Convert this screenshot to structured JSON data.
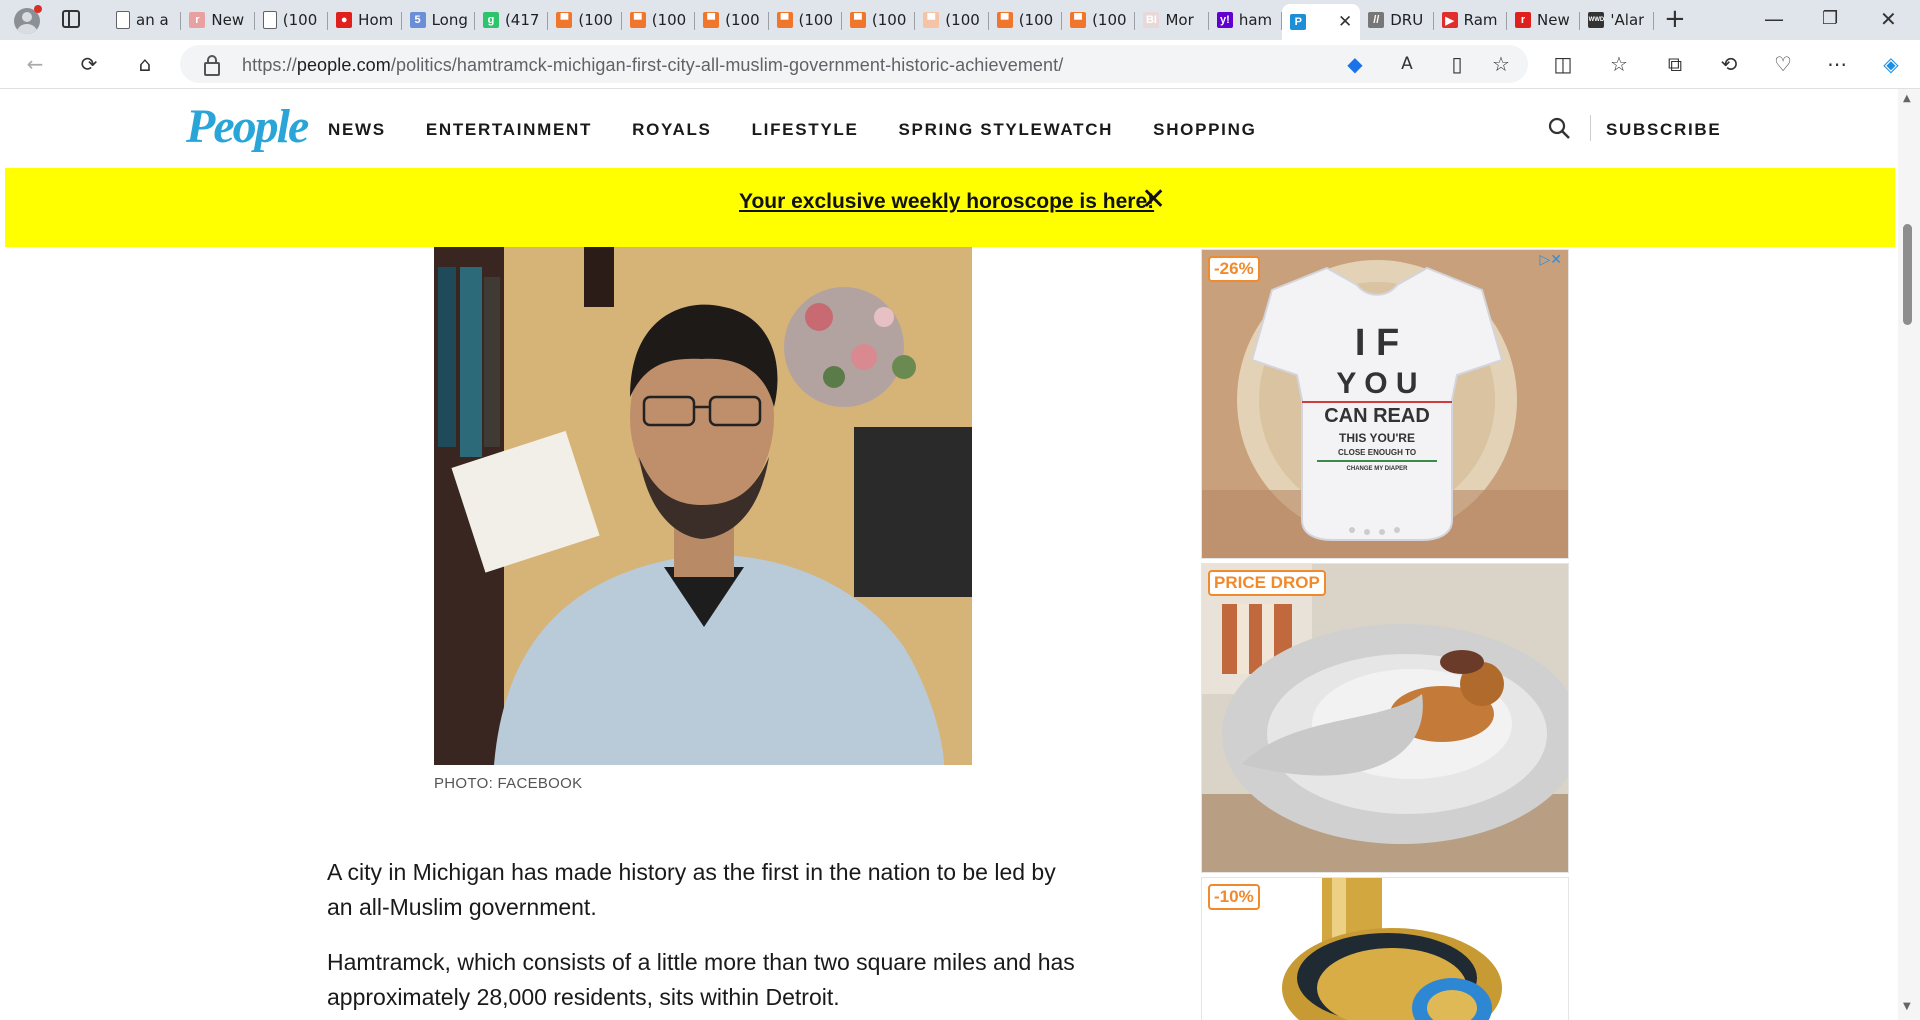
{
  "browser": {
    "tabs": [
      {
        "title": "an a",
        "icon": "page-icon",
        "color": "#e8eaed"
      },
      {
        "title": "New",
        "icon": "r-icon",
        "color": "#e8a0a0"
      },
      {
        "title": "(100",
        "icon": "page-icon",
        "color": "#e8eaed"
      },
      {
        "title": "Hom",
        "icon": "red-circle-icon",
        "color": "#e0201c"
      },
      {
        "title": "Long",
        "icon": "five-icon",
        "color": "#6a8fd6"
      },
      {
        "title": "(417",
        "icon": "g-icon",
        "color": "#2ec46d"
      },
      {
        "title": "(100",
        "icon": "bookmark-icon",
        "color": "#f0762c"
      },
      {
        "title": "(100",
        "icon": "bookmark-icon",
        "color": "#f0762c"
      },
      {
        "title": "(100",
        "icon": "bookmark-icon",
        "color": "#f0762c"
      },
      {
        "title": "(100",
        "icon": "bookmark-icon",
        "color": "#f0762c"
      },
      {
        "title": "(100",
        "icon": "bookmark-icon",
        "color": "#f0762c"
      },
      {
        "title": "(100",
        "icon": "bookmark-icon",
        "color": "#f5c4a6"
      },
      {
        "title": "(100",
        "icon": "bookmark-icon",
        "color": "#f0762c"
      },
      {
        "title": "(100",
        "icon": "bookmark-icon",
        "color": "#f0762c"
      },
      {
        "title": "Mor",
        "icon": "bi-icon",
        "color": "#e8d8d8"
      },
      {
        "title": "ham",
        "icon": "yahoo-icon",
        "color": "#6001d2"
      },
      {
        "title": "",
        "icon": "people-p-icon",
        "color": "#1c8fd6",
        "active": true
      },
      {
        "title": "DRU",
        "icon": "drudge-icon",
        "color": "#777777"
      },
      {
        "title": "Ram",
        "icon": "youtube-icon",
        "color": "#e02d2d"
      },
      {
        "title": "New",
        "icon": "r-icon",
        "color": "#e0201c"
      },
      {
        "title": "'Alar",
        "icon": "wwd-icon",
        "color": "#333333"
      }
    ],
    "url_host": "people.com",
    "url_prefix": "https://",
    "url_path": "/politics/hamtramck-michigan-first-city-all-muslim-government-historic-achievement/"
  },
  "site": {
    "logo": "People",
    "nav": [
      "NEWS",
      "ENTERTAINMENT",
      "ROYALS",
      "LIFESTYLE",
      "SPRING STYLEWATCH",
      "SHOPPING"
    ],
    "subscribe": "SUBSCRIBE",
    "brand_color": "#2aa5d8"
  },
  "banner": {
    "text": "Your exclusive weekly horoscope is here!",
    "close": "✕",
    "color": "#ffff00"
  },
  "article": {
    "caption": "PHOTO: FACEBOOK",
    "paragraphs": [
      "A city in Michigan has made history as the first in the nation to be led by an all-Muslim government.",
      "Hamtramck, which consists of a little more than two square miles and has approximately 28,000 residents, sits within Detroit."
    ]
  },
  "ads": [
    {
      "badge": "-26%",
      "shirt_lines": [
        "I F",
        "Y O U",
        "CAN READ",
        "THIS YOU'RE",
        "CLOSE ENOUGH TO",
        "CHANGE MY DIAPER"
      ]
    },
    {
      "badge": "PRICE DROP"
    },
    {
      "badge": "-10%"
    }
  ]
}
